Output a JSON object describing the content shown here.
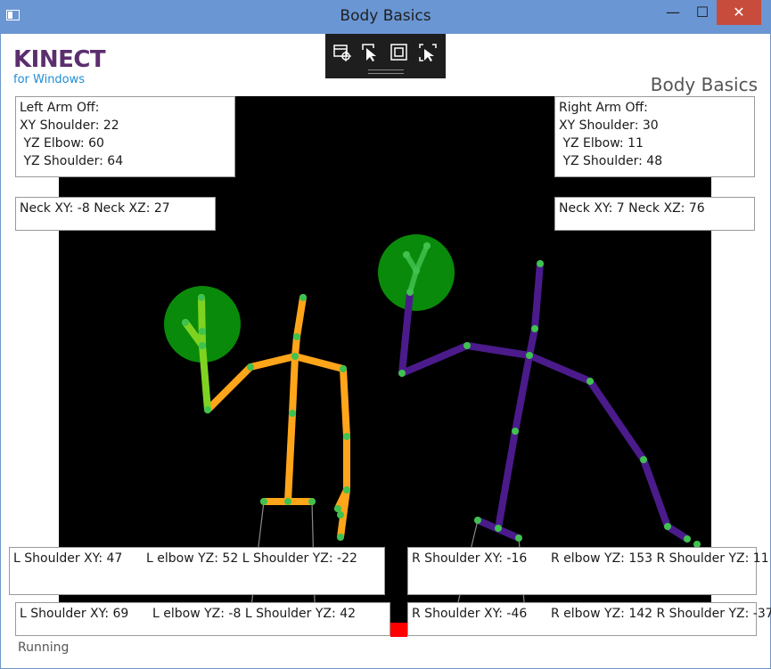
{
  "window": {
    "title": "Body Basics",
    "min_glyph": "—",
    "max_glyph": "☐",
    "close_glyph": "✕"
  },
  "logo": {
    "main": "KINECT",
    "sub": "for Windows"
  },
  "app_title": "Body Basics",
  "toolbar": {
    "icons": [
      "select-element-icon",
      "pointer-select-icon",
      "display-layout-icon",
      "track-focus-icon"
    ]
  },
  "left_arm": {
    "line1": "Left Arm Off:",
    "line2": "XY Shoulder: 22",
    "line3": " YZ Elbow: 60",
    "line4": " YZ Shoulder: 64"
  },
  "right_arm": {
    "line1": "Right Arm Off:",
    "line2": "XY Shoulder: 30",
    "line3": " YZ Elbow: 11",
    "line4": " YZ Shoulder: 48"
  },
  "neck_left": "Neck XY: -8 Neck XZ: 27",
  "neck_right": "Neck XY: 7 Neck XZ: 76",
  "bottom_left_1": "L Shoulder XY: 47      L elbow YZ: 52 L Shoulder YZ: -22",
  "bottom_right_1": "R Shoulder XY: -16      R elbow YZ: 153 R Shoulder YZ: 11",
  "bottom_left_2": "L Shoulder XY: 69      L elbow YZ: -8 L Shoulder YZ: 42",
  "bottom_right_2": "R Shoulder XY: -46      R elbow YZ: 142 R Shoulder YZ: -37",
  "status": "Running",
  "colors": {
    "body1": "#ffa51a",
    "body2": "#4b1b8c",
    "joint": "#3fc24f",
    "hand": "#0a8a0a",
    "titlebar": "#6a96d3",
    "logo": "#5b2e6e",
    "logo_sub": "#1f8dd6"
  }
}
